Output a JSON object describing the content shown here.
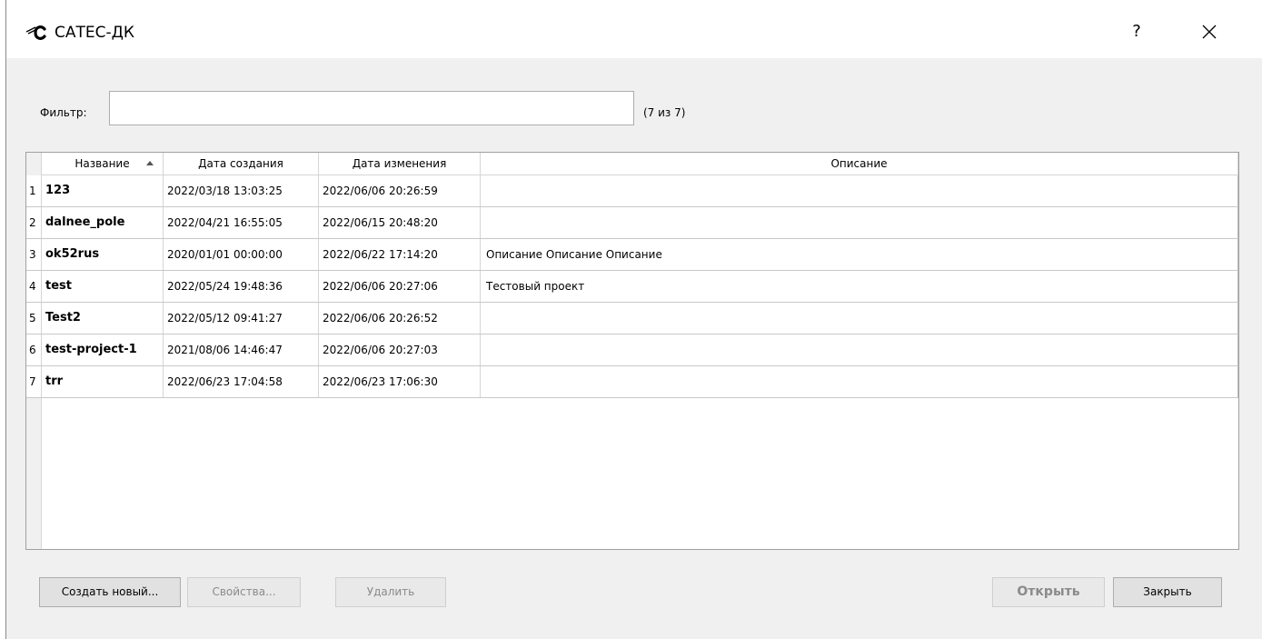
{
  "window": {
    "title": "САТЕС-ДК",
    "help_label": "?"
  },
  "filter": {
    "label": "Фильтр:",
    "value": "",
    "placeholder": "",
    "count": "(7 из 7)"
  },
  "table": {
    "columns": [
      "Название",
      "Дата создания",
      "Дата изменения",
      "Описание"
    ],
    "sorted_column": "Название",
    "sort_direction": "ascending",
    "rows": [
      {
        "num": "1",
        "name": "123",
        "created": "2022/03/18 13:03:25",
        "modified": "2022/06/06 20:26:59",
        "description": ""
      },
      {
        "num": "2",
        "name": "dalnee_pole",
        "created": "2022/04/21 16:55:05",
        "modified": "2022/06/15 20:48:20",
        "description": ""
      },
      {
        "num": "3",
        "name": "ok52rus",
        "created": "2020/01/01 00:00:00",
        "modified": "2022/06/22 17:14:20",
        "description": "Описание Описание Описание"
      },
      {
        "num": "4",
        "name": "test",
        "created": "2022/05/24 19:48:36",
        "modified": "2022/06/06 20:27:06",
        "description": "Тестовый проект"
      },
      {
        "num": "5",
        "name": "Test2",
        "created": "2022/05/12 09:41:27",
        "modified": "2022/06/06 20:26:52",
        "description": ""
      },
      {
        "num": "6",
        "name": "test-project-1",
        "created": "2021/08/06 14:46:47",
        "modified": "2022/06/06 20:27:03",
        "description": ""
      },
      {
        "num": "7",
        "name": "trr",
        "created": "2022/06/23 17:04:58",
        "modified": "2022/06/23 17:06:30",
        "description": ""
      }
    ]
  },
  "buttons": {
    "create": "Создать новый...",
    "properties": "Свойства...",
    "delete": "Удалить",
    "open": "Открыть",
    "close": "Закрыть"
  },
  "icons": {
    "logo": "satec-logo-icon",
    "close": "close-icon",
    "sort": "sort-ascending-icon"
  }
}
